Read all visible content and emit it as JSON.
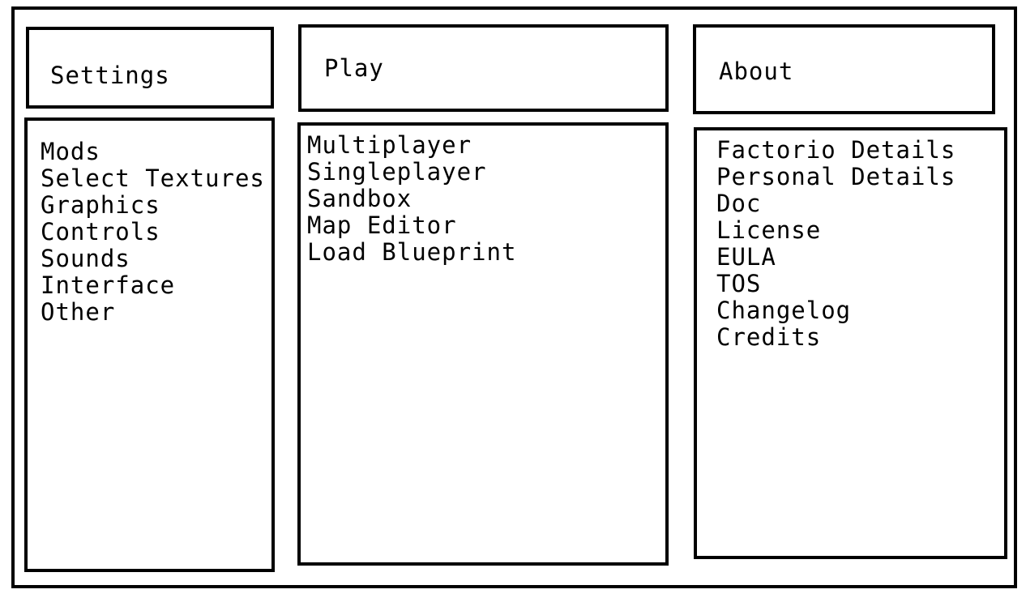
{
  "settings": {
    "title": "Settings",
    "items": [
      "Mods",
      "Select Textures",
      "Graphics",
      "Controls",
      "Sounds",
      "Interface",
      "Other"
    ]
  },
  "play": {
    "title": "Play",
    "items": [
      "Multiplayer",
      "Singleplayer",
      "Sandbox",
      "Map Editor",
      "Load Blueprint"
    ]
  },
  "about": {
    "title": "About",
    "items": [
      "Factorio Details",
      "Personal Details",
      "Doc",
      "License",
      "EULA",
      "TOS",
      "Changelog",
      "Credits"
    ]
  }
}
